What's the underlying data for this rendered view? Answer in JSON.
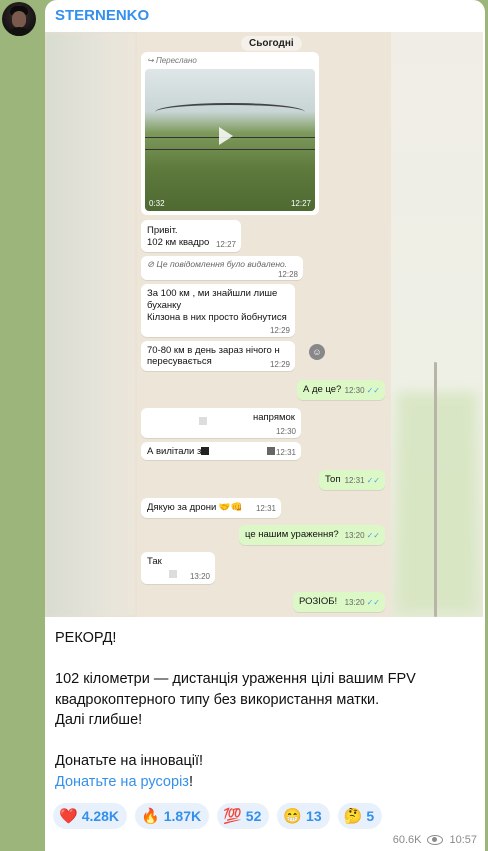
{
  "post": {
    "channel_name": "STERNENKO",
    "views": "60.6K",
    "time": "10:57"
  },
  "screenshot_chat": {
    "date_label": "Сьогодні",
    "forwarded_label": "Переслано",
    "video_duration": "0:32",
    "video_time": "12:27",
    "messages": [
      {
        "text1": "Привіт.",
        "text2": "102 км квадро",
        "time": "12:27"
      },
      {
        "text": "Це повідомлення було видалено.",
        "time": "12:28"
      },
      {
        "text1": "За 100 км , ми знайшли лише",
        "text2": "буханку",
        "text3": "Кілзона в них просто йобнутися",
        "time": "12:29"
      },
      {
        "text1": "70-80 км в день зараз нічого н",
        "text2": "пересувається",
        "time": "12:29"
      },
      {
        "text": "А де це?",
        "time": "12:30"
      },
      {
        "text": "напрямок",
        "time": "12:30"
      },
      {
        "text": "А вилітали з",
        "time": "12:31"
      },
      {
        "text": "Топ",
        "time": "12:31"
      },
      {
        "text": "Дякую за дрони 🤝👊",
        "time": "12:31"
      },
      {
        "text": "це нашим ураження?",
        "time": "13:20"
      },
      {
        "text": "Так",
        "time": "13:20"
      },
      {
        "text": "РОЗІОБ!",
        "time": "13:20"
      }
    ]
  },
  "body": {
    "line1": "РЕКОРД!",
    "line2": "102 кілометри — дистанція ураження цілі вашим FPV",
    "line3": "квадрокоптерного типу без використання матки.",
    "line4": "Далі глибше!",
    "line5": "Донатьте на інновації!",
    "line6_link": "Донатьте на русоріз",
    "line6_tail": "!"
  },
  "reactions": [
    {
      "emoji": "❤️",
      "icon": "heart-icon",
      "count": "4.28K"
    },
    {
      "emoji": "🔥",
      "icon": "fire-icon",
      "count": "1.87K"
    },
    {
      "emoji": "💯",
      "icon": "hundred-icon",
      "count": "52"
    },
    {
      "emoji": "😁",
      "icon": "grin-icon",
      "count": "13"
    },
    {
      "emoji": "🤔",
      "icon": "thinking-icon",
      "count": "5"
    }
  ],
  "colors": {
    "accent": "#3390ec",
    "out_bubble": "#dcf8c6",
    "background": "#9bb57a"
  }
}
